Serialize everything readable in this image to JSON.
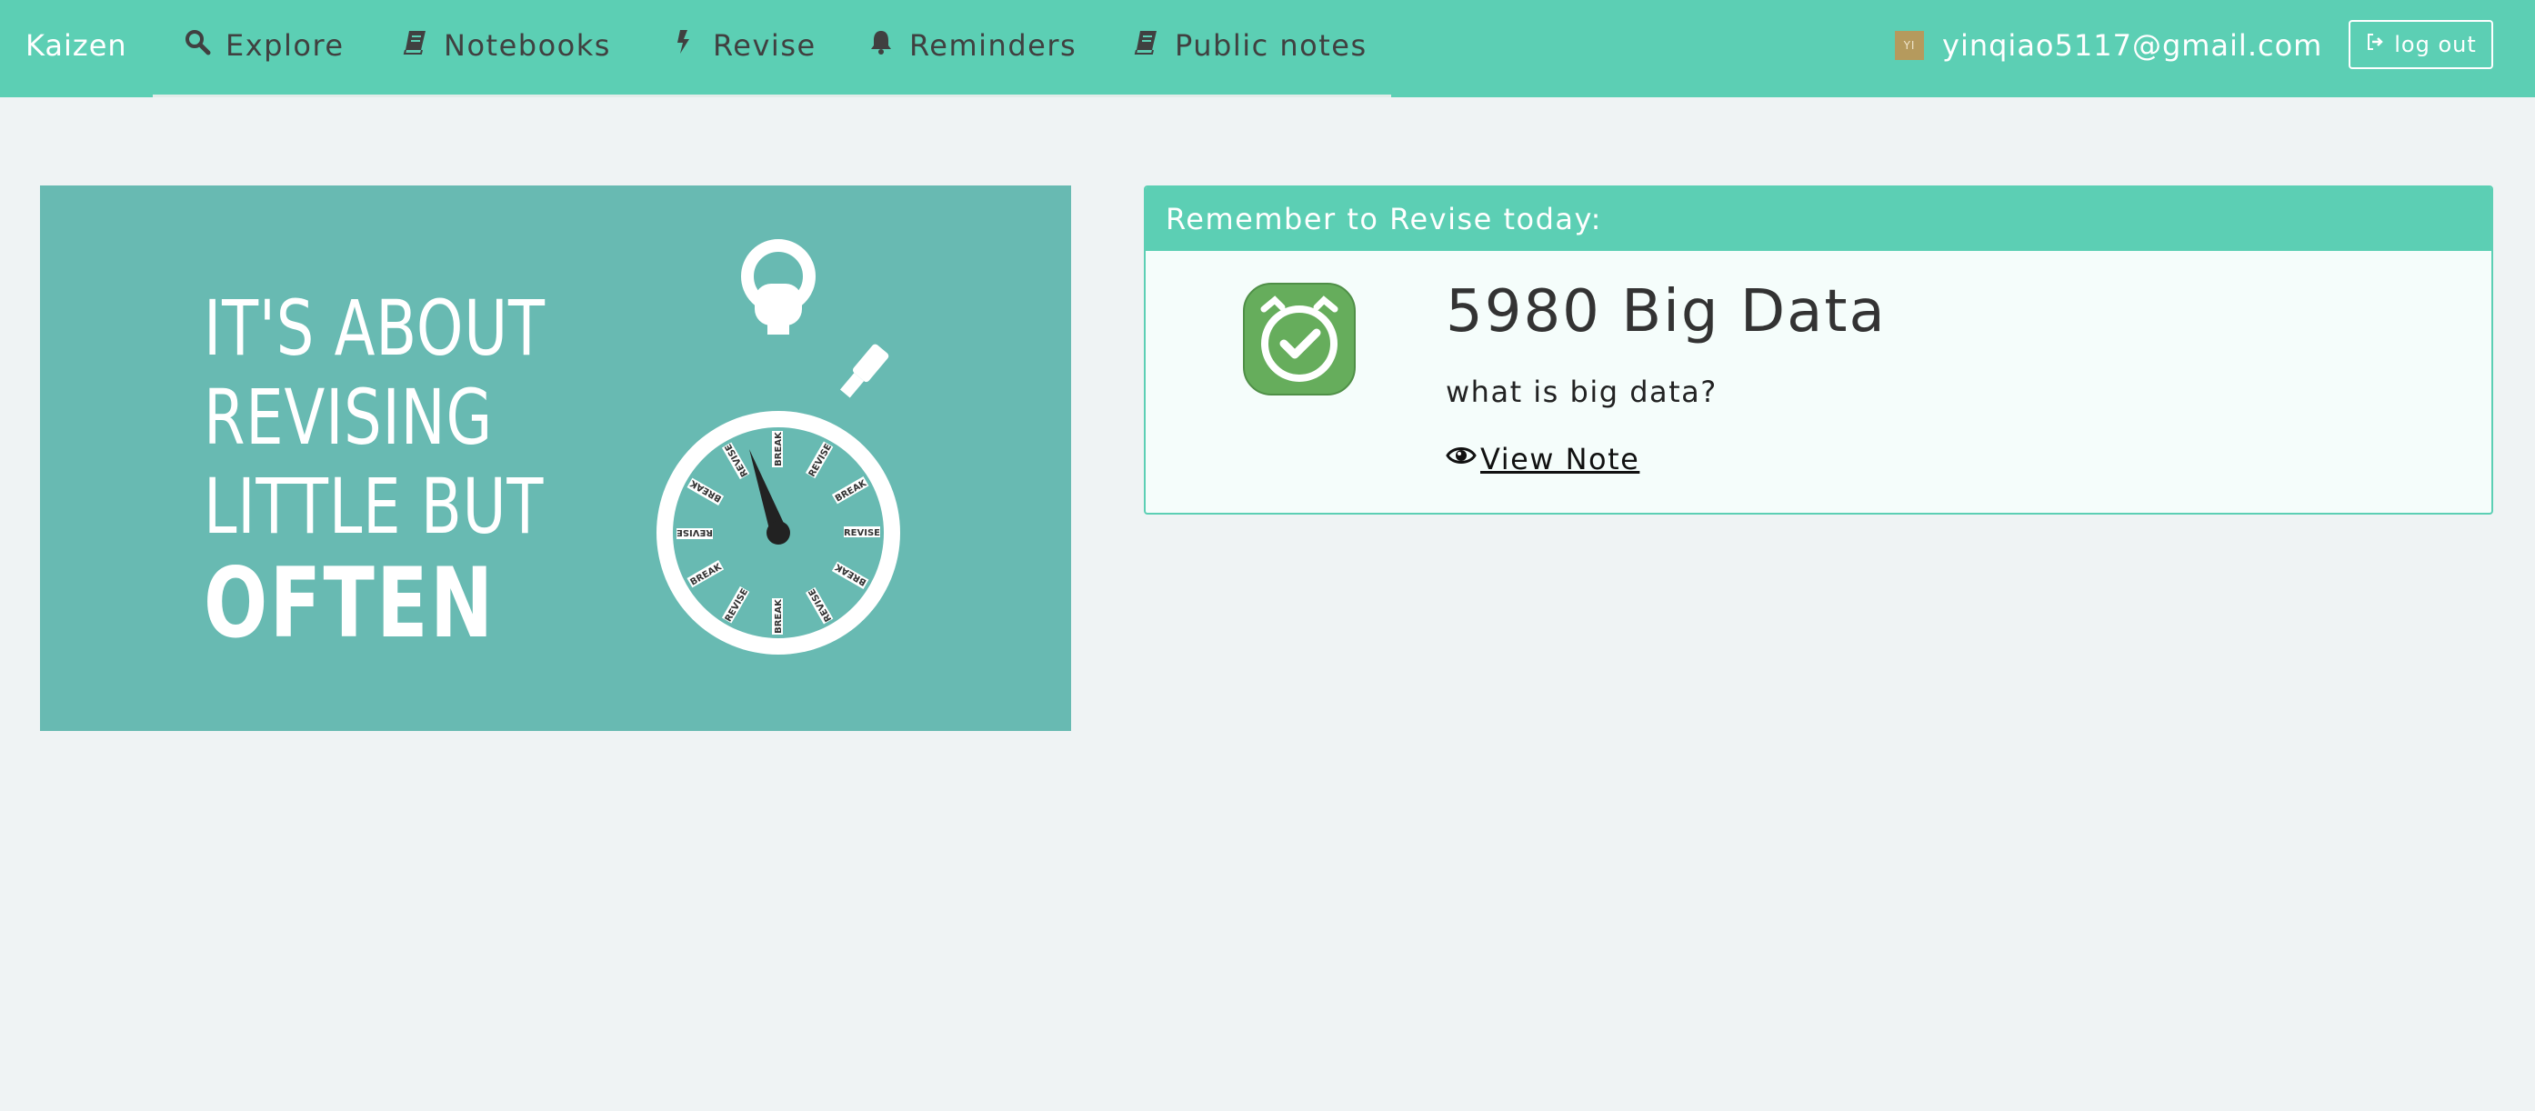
{
  "nav": {
    "brand": "Kaizen",
    "items": [
      {
        "label": "Explore",
        "icon": "search-icon"
      },
      {
        "label": "Notebooks",
        "icon": "book-icon"
      },
      {
        "label": "Revise",
        "icon": "bolt-icon"
      },
      {
        "label": "Reminders",
        "icon": "bell-icon"
      },
      {
        "label": "Public notes",
        "icon": "book-icon"
      }
    ],
    "user": {
      "email": "yinqiao5117@gmail.com",
      "avatar_initials": "YI"
    },
    "logout_label": "log out"
  },
  "hero": {
    "lines": [
      "IT'S ABOUT",
      "REVISING",
      "LITTLE BUT",
      "OFTEN"
    ],
    "dial_labels": [
      "BREAK",
      "REVISE"
    ]
  },
  "reminder": {
    "header": "Remember to Revise today:",
    "title": "5980 Big Data",
    "question": "what is big data?",
    "link_label": "View Note"
  },
  "colors": {
    "accent": "#5ccfb4",
    "background": "#eff3f4",
    "hero_bg": "#68bab2",
    "icon_green": "#66ad5c"
  }
}
